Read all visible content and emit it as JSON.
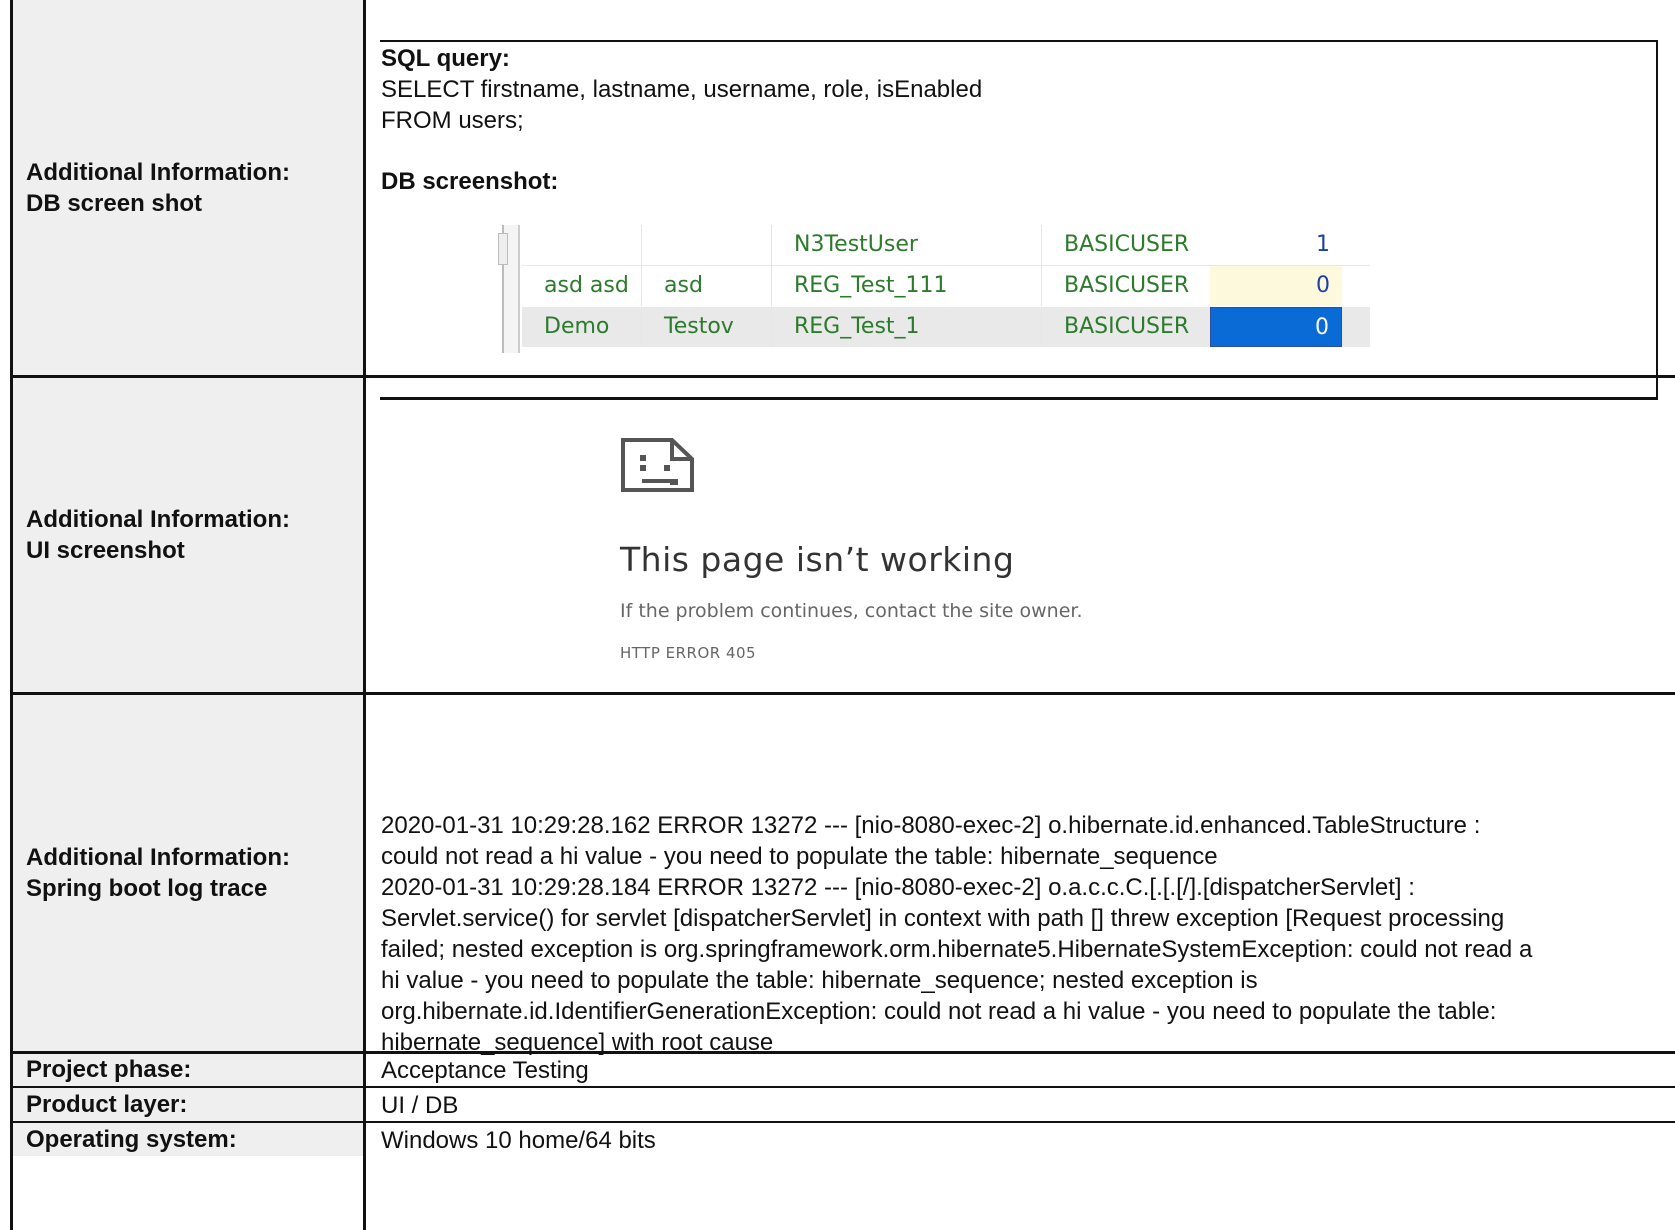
{
  "rows": {
    "db": {
      "label_line1": "Additional Information:",
      "label_line2": "DB screen shot",
      "sql_heading": "SQL query:",
      "sql_line1": "SELECT firstname, lastname, username, role, isEnabled",
      "sql_line2": "FROM users;",
      "db_heading": "DB screenshot:",
      "grid": [
        {
          "firstname": "",
          "lastname": "",
          "username": "N3TestUser",
          "role": "BASICUSER",
          "isEnabled": "1"
        },
        {
          "firstname": "asd asd",
          "lastname": "asd",
          "username": "REG_Test_111",
          "role": "BASICUSER",
          "isEnabled": "0"
        },
        {
          "firstname": "Demo",
          "lastname": "Testov",
          "username": "REG_Test_1",
          "role": "BASICUSER",
          "isEnabled": "0"
        }
      ]
    },
    "ui": {
      "label_line1": "Additional Information:",
      "label_line2": "UI screenshot",
      "error_icon": "sad-page-icon",
      "error_title": "This page isn’t working",
      "error_subtitle": "If the problem continues, contact the site owner.",
      "error_code": "HTTP ERROR 405"
    },
    "log": {
      "label_line1": "Additional Information:",
      "label_line2": "Spring boot log trace",
      "lines": [
        "2020-01-31 10:29:28.162 ERROR 13272 --- [nio-8080-exec-2] o.hibernate.id.enhanced.TableStructure   :",
        "could not read a hi value - you need to populate the table: hibernate_sequence",
        "2020-01-31 10:29:28.184 ERROR 13272 --- [nio-8080-exec-2] o.a.c.c.C.[.[.[/].[dispatcherServlet]    :",
        "Servlet.service() for servlet [dispatcherServlet] in context with path [] threw exception [Request processing",
        "failed; nested exception is org.springframework.orm.hibernate5.HibernateSystemException: could not read a",
        "hi value - you need to populate the table: hibernate_sequence; nested exception is",
        "org.hibernate.id.IdentifierGenerationException: could not read a hi value - you need to populate the table:",
        "hibernate_sequence] with root cause"
      ]
    },
    "project_phase": {
      "label": "Project phase:",
      "value": "Acceptance Testing"
    },
    "product_layer": {
      "label": "Product layer:",
      "value": "UI / DB"
    },
    "operating_system": {
      "label": "Operating system:",
      "value": "Windows 10 home/64 bits"
    }
  }
}
